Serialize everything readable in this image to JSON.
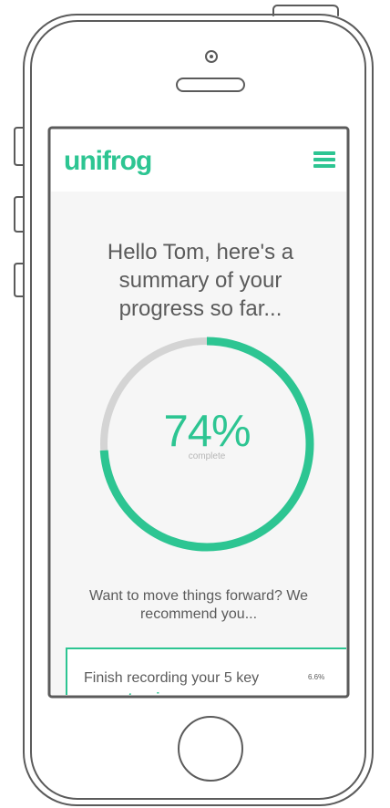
{
  "device": {
    "frame_color": "#5b5b5b",
    "screen_background": "#f6f6f6",
    "home_button": "home-button",
    "camera_icon": "front-camera-icon",
    "speaker_icon": "speaker-icon"
  },
  "header": {
    "logo": "unifrog",
    "menu_icon": "hamburger-menu-icon",
    "accent_color": "#2dc592"
  },
  "summary": {
    "greeting_line_1": "Hello Tom, here's a",
    "greeting_line_2": "summary of your",
    "greeting_line_3": "progress so far...",
    "progress_value": 74,
    "progress_display": "74%",
    "progress_label": "complete",
    "progress_color": "#2dc592",
    "track_color": "#d4d4d4"
  },
  "recommendation": {
    "line_1": "Want to move things forward? We",
    "line_2": "recommend you...",
    "task": {
      "text": "Finish recording your 5 key",
      "link": "competencies",
      "percent": "6.6%"
    }
  }
}
